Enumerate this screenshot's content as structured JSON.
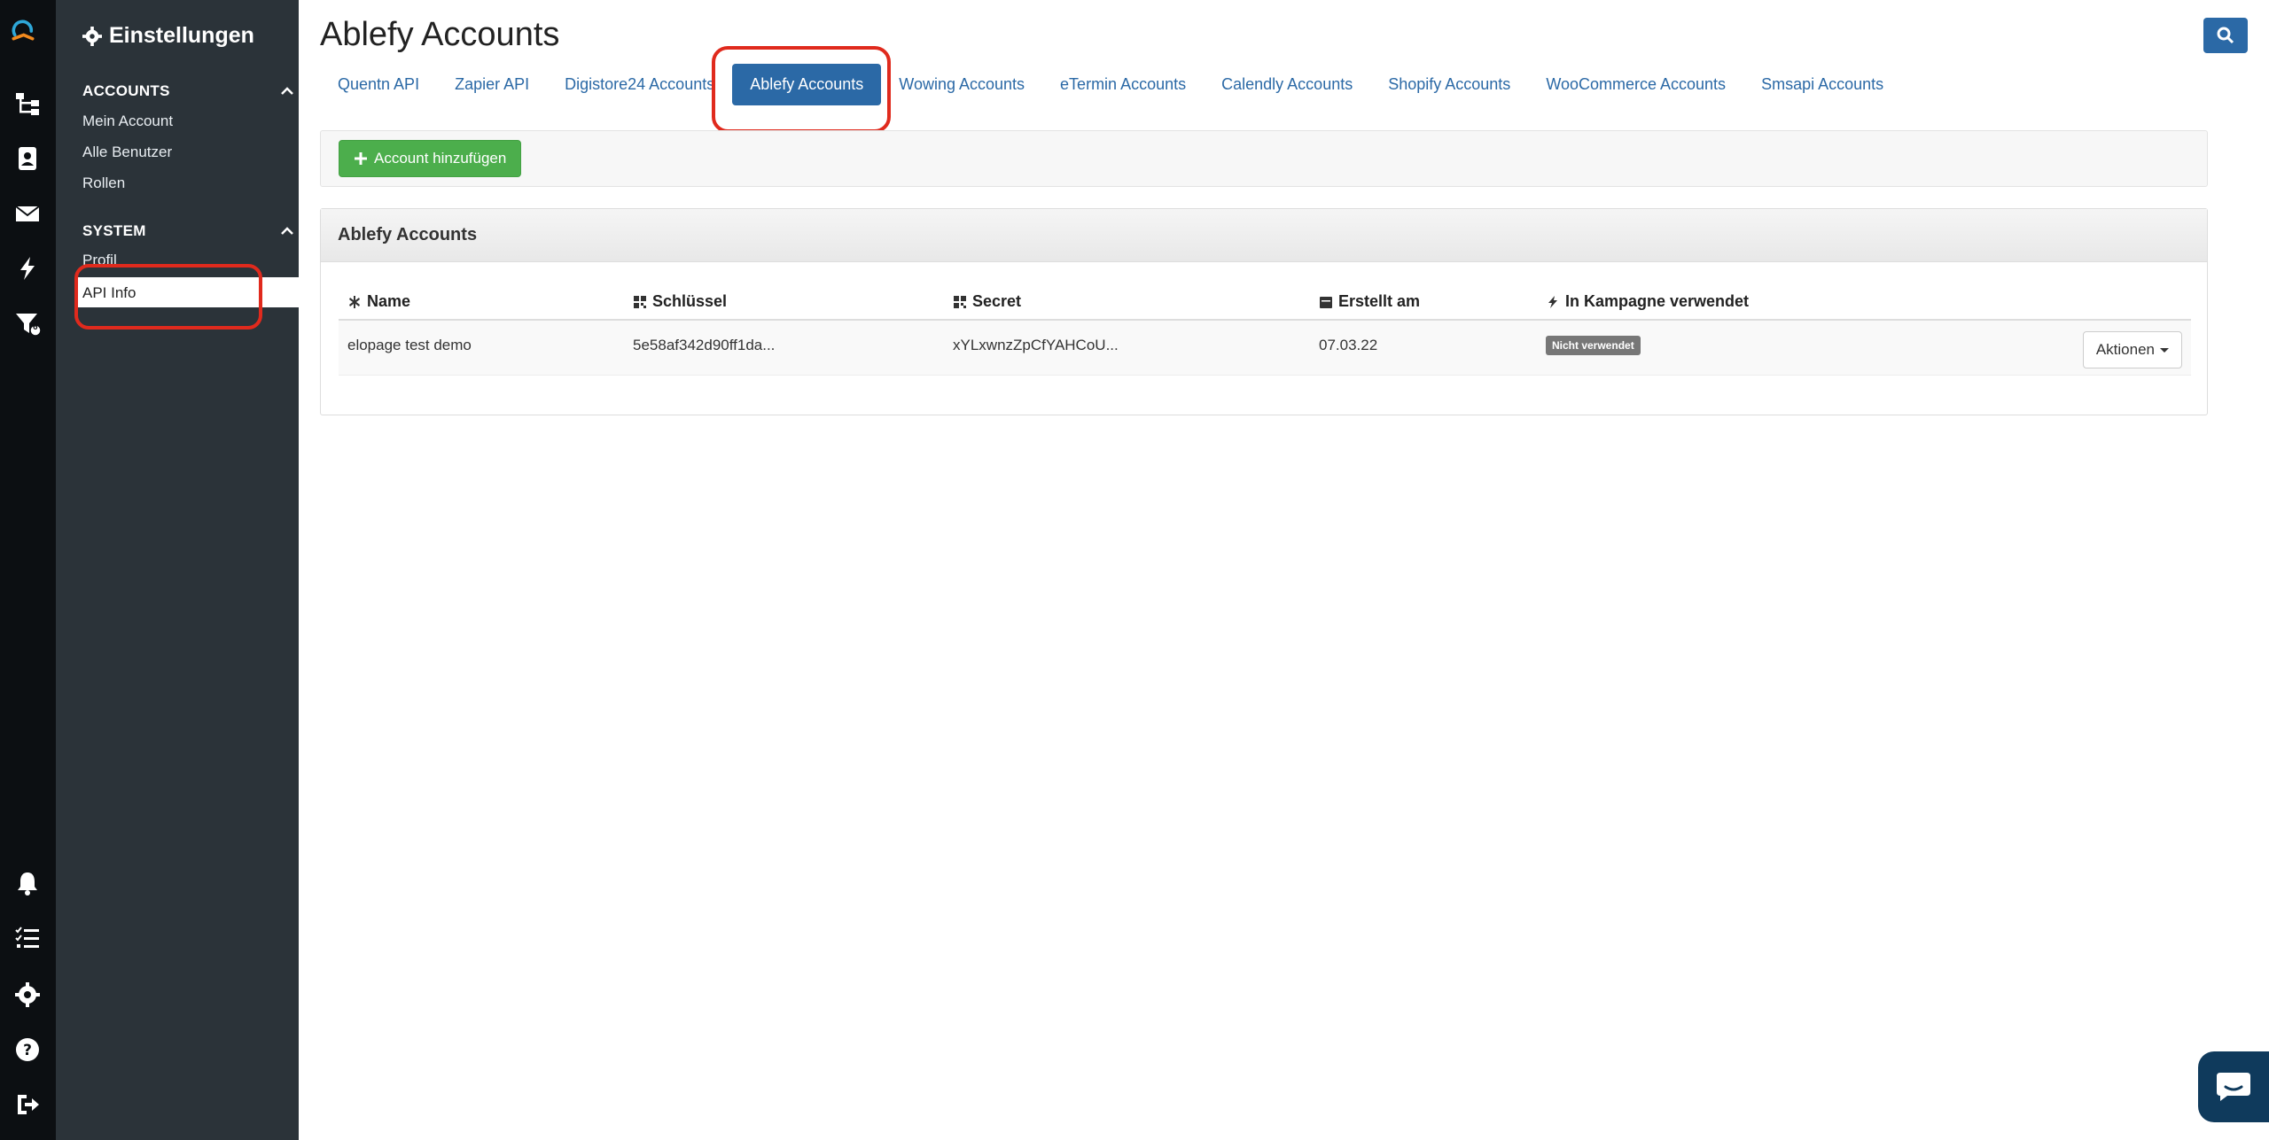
{
  "sidebar": {
    "title": "Einstellungen",
    "sections": [
      {
        "label": "ACCOUNTS",
        "items": [
          "Mein Account",
          "Alle Benutzer",
          "Rollen"
        ]
      },
      {
        "label": "SYSTEM",
        "items": [
          "Profil",
          "API Info"
        ]
      }
    ],
    "active_item": "API Info"
  },
  "rail": {
    "icons": [
      "logo-icon",
      "sitemap-icon",
      "contacts-icon",
      "envelope-icon",
      "bolt-icon",
      "funnel-icon",
      "bell-icon",
      "tasks-icon",
      "gear-icon",
      "help-icon",
      "logout-icon"
    ],
    "funnel_badge": "6"
  },
  "header": {
    "title": "Ablefy Accounts"
  },
  "tabs": [
    {
      "label": "Quentn API"
    },
    {
      "label": "Zapier API"
    },
    {
      "label": "Digistore24 Accounts"
    },
    {
      "label": "Ablefy Accounts",
      "active": true
    },
    {
      "label": "Wowing Accounts"
    },
    {
      "label": "eTermin Accounts"
    },
    {
      "label": "Calendly Accounts"
    },
    {
      "label": "Shopify Accounts"
    },
    {
      "label": "WooCommerce Accounts"
    },
    {
      "label": "Smsapi Accounts"
    }
  ],
  "toolbar": {
    "add_label": "Account hinzufügen"
  },
  "panel": {
    "title": "Ablefy Accounts",
    "columns": [
      "Name",
      "Schlüssel",
      "Secret",
      "Erstellt am",
      "In Kampagne verwendet"
    ],
    "rows": [
      {
        "name": "elopage test demo",
        "key": "5e58af342d90ff1da...",
        "secret": "xYLxwnzZpCfYAHCoU...",
        "created": "07.03.22",
        "used": "Nicht verwendet",
        "actions_label": "Aktionen"
      }
    ]
  },
  "colors": {
    "accent": "#2b69a6",
    "success": "#4cae4c",
    "highlight": "#e02a1d",
    "sidebar": "#2b3339",
    "rail": "#0c0f12"
  }
}
